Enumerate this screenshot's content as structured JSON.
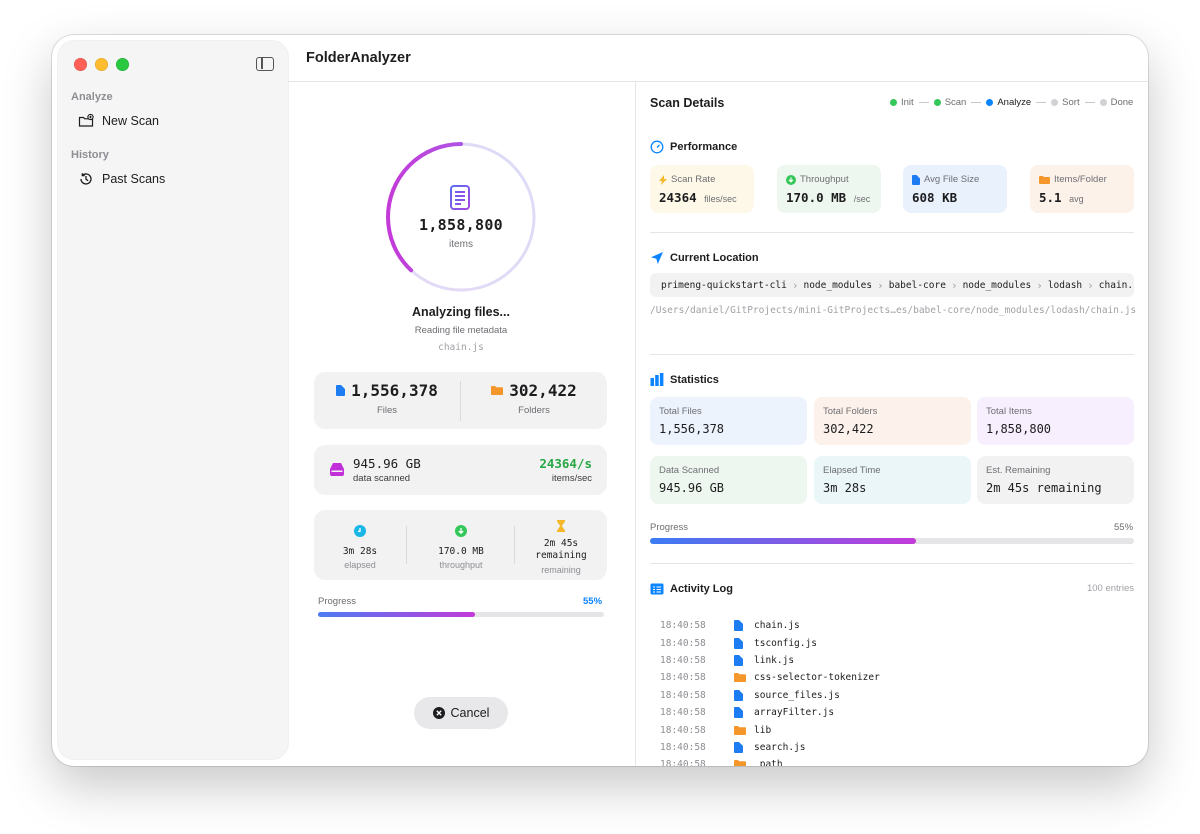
{
  "app": {
    "title": "FolderAnalyzer"
  },
  "sidebar": {
    "sections": [
      {
        "label": "Analyze",
        "items": [
          {
            "label": "New Scan",
            "icon": "folder-badge-plus-icon"
          }
        ]
      },
      {
        "label": "History",
        "items": [
          {
            "label": "Past Scans",
            "icon": "clock-history-icon"
          }
        ]
      }
    ]
  },
  "progress_panel": {
    "ring_count": "1,858,800",
    "ring_unit": "items",
    "ring_fraction": 0.55,
    "status_title": "Analyzing files...",
    "status_subtitle": "Reading file metadata",
    "current_file": "chain.js",
    "files_value": "1,556,378",
    "files_label": "Files",
    "folders_value": "302,422",
    "folders_label": "Folders",
    "data_value": "945.96 GB",
    "data_label": "data scanned",
    "rate_value": "24364/s",
    "rate_label": "items/sec",
    "elapsed_value": "3m 28s",
    "elapsed_label": "elapsed",
    "throughput_value": "170.0 MB",
    "throughput_label": "throughput",
    "remaining_value_line1": "2m 45s",
    "remaining_value_line2": "remaining",
    "remaining_label": "remaining",
    "progress_label": "Progress",
    "progress_percent": "55%",
    "progress_fraction": 0.55,
    "cancel_label": "Cancel"
  },
  "details": {
    "title": "Scan Details",
    "steps": [
      {
        "label": "Init",
        "state": "done",
        "color": "#34c759"
      },
      {
        "label": "Scan",
        "state": "done",
        "color": "#34c759"
      },
      {
        "label": "Analyze",
        "state": "active",
        "color": "#0a84ff"
      },
      {
        "label": "Sort",
        "state": "pending",
        "color": "#d1d1d6"
      },
      {
        "label": "Done",
        "state": "pending",
        "color": "#d1d1d6"
      }
    ],
    "performance": {
      "heading": "Performance",
      "cards": [
        {
          "label": "Scan Rate",
          "value": "24364",
          "unit": "files/sec",
          "bg": "#fdf8e7",
          "icon": "bolt-icon"
        },
        {
          "label": "Throughput",
          "value": "170.0 MB",
          "unit": "/sec",
          "bg": "#eef7ef",
          "icon": "download-circle-icon"
        },
        {
          "label": "Avg File Size",
          "value": "608 KB",
          "unit": "",
          "bg": "#e9f1fd",
          "icon": "doc-icon"
        },
        {
          "label": "Items/Folder",
          "value": "5.1",
          "unit": "avg",
          "bg": "#fdf2ea",
          "icon": "folder-icon"
        }
      ]
    },
    "location": {
      "heading": "Current Location",
      "crumbs": [
        "primeng-quickstart-cli",
        "node_modules",
        "babel-core",
        "node_modules",
        "lodash",
        "chain.js"
      ],
      "full_path": "/Users/daniel/GitProjects/mini-GitProjects…es/babel-core/node_modules/lodash/chain.js"
    },
    "statistics": {
      "heading": "Statistics",
      "cards": [
        {
          "label": "Total Files",
          "value": "1,556,378",
          "bg": "#edf3fd"
        },
        {
          "label": "Total Folders",
          "value": "302,422",
          "bg": "#fdf2eb"
        },
        {
          "label": "Total Items",
          "value": "1,858,800",
          "bg": "#f7effd"
        },
        {
          "label": "Data Scanned",
          "value": "945.96 GB",
          "bg": "#eef7ef"
        },
        {
          "label": "Elapsed Time",
          "value": "3m 28s",
          "bg": "#eaf6f8"
        },
        {
          "label": "Est. Remaining",
          "value": "2m 45s remaining",
          "bg": "#f2f2f3"
        }
      ],
      "progress_label": "Progress",
      "progress_percent": "55%",
      "progress_fraction": 0.55
    },
    "activity": {
      "heading": "Activity Log",
      "count": "100 entries",
      "rows": [
        {
          "time": "18:40:58",
          "type": "file",
          "name": "chain.js"
        },
        {
          "time": "18:40:58",
          "type": "file",
          "name": "tsconfig.js"
        },
        {
          "time": "18:40:58",
          "type": "file",
          "name": "link.js"
        },
        {
          "time": "18:40:58",
          "type": "folder",
          "name": "css-selector-tokenizer"
        },
        {
          "time": "18:40:58",
          "type": "file",
          "name": "source_files.js"
        },
        {
          "time": "18:40:58",
          "type": "file",
          "name": "arrayFilter.js"
        },
        {
          "time": "18:40:58",
          "type": "folder",
          "name": "lib"
        },
        {
          "time": "18:40:58",
          "type": "file",
          "name": "search.js"
        },
        {
          "time": "18:40:58",
          "type": "folder",
          "name": "_path"
        }
      ]
    }
  },
  "colors": {
    "accent_blue": "#0a84ff",
    "accent_purple": "#b44be1",
    "rate_green": "#28a745",
    "file_blue": "#1e7cf2",
    "folder_orange": "#f5962b"
  }
}
